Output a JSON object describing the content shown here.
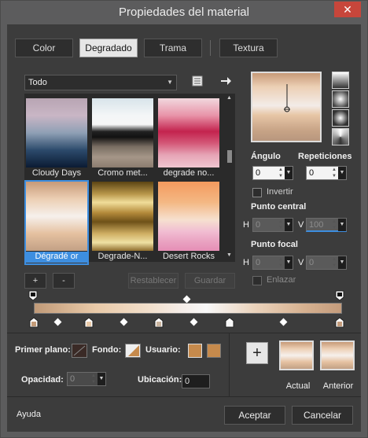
{
  "window": {
    "title": "Propiedades del material",
    "close": "✕"
  },
  "tabs": [
    {
      "label": "Color",
      "selected": false
    },
    {
      "label": "Degradado",
      "selected": true
    },
    {
      "label": "Trama",
      "selected": false
    },
    {
      "label": "Textura",
      "selected": false
    }
  ],
  "category": {
    "value": "Todo"
  },
  "gallery": [
    {
      "label": "Cloudy Days",
      "selected": false
    },
    {
      "label": "Cromo met...",
      "selected": false
    },
    {
      "label": "degrade no...",
      "selected": false
    },
    {
      "label": "Dégradé or",
      "selected": true
    },
    {
      "label": "Degrade-N...",
      "selected": false
    },
    {
      "label": "Desert Rocks",
      "selected": false
    }
  ],
  "buttons": {
    "add": "+",
    "remove": "-",
    "reset": "Restablecer",
    "save": "Guardar"
  },
  "angle": {
    "label": "Ángulo",
    "value": "0"
  },
  "repeats": {
    "label": "Repeticiones",
    "value": "0"
  },
  "invert": {
    "label": "Invertir",
    "checked": false
  },
  "center": {
    "label": "Punto central",
    "h_label": "H",
    "h_value": "0",
    "v_label": "V",
    "v_value": "100"
  },
  "focal": {
    "label": "Punto focal",
    "h_label": "H",
    "h_value": "0",
    "v_label": "V",
    "v_value": "0"
  },
  "link": {
    "label": "Enlazar",
    "checked": false
  },
  "bottom": {
    "foreground_label": "Primer plano:",
    "background_label": "Fondo:",
    "user_label": "Usuario:",
    "opacity_label": "Opacidad:",
    "opacity_value": "0",
    "location_label": "Ubicación:",
    "location_value": "0",
    "plus": "+",
    "current_label": "Actual",
    "previous_label": "Anterior",
    "user_color": "#c68a4c"
  },
  "footer": {
    "help": "Ayuda",
    "ok": "Aceptar",
    "cancel": "Cancelar"
  }
}
